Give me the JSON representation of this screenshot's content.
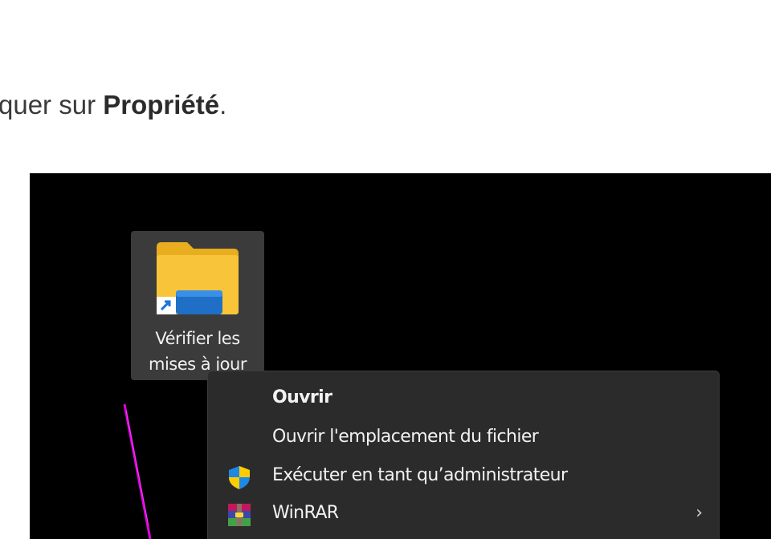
{
  "article": {
    "text_before": "quer sur ",
    "text_bold": "Propriété",
    "text_after": "."
  },
  "desktop_icon": {
    "label_line1": "Vérifier les",
    "label_line2": "mises à jour"
  },
  "context_menu": {
    "items": [
      {
        "label": "Ouvrir",
        "bold": true,
        "icon": null
      },
      {
        "label": "Ouvrir l'emplacement du fichier",
        "bold": false,
        "icon": null
      },
      {
        "label": "Exécuter en tant qu’administrateur",
        "bold": false,
        "icon": "uac-shield-icon"
      },
      {
        "label": "WinRAR",
        "bold": false,
        "icon": "winrar-icon",
        "submenu": true
      }
    ],
    "submenu_glyph": "›"
  },
  "colors": {
    "desktop_bg": "#000000",
    "menu_bg": "#2b2b2b",
    "streak": "#e000e0",
    "folder": "#f8c53a"
  }
}
